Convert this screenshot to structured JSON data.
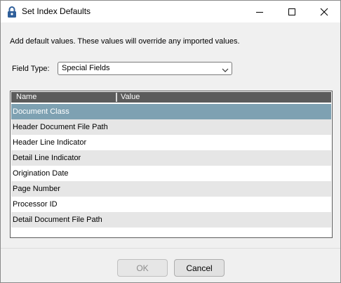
{
  "window": {
    "title": "Set Index Defaults"
  },
  "description": "Add default values. These values will override any imported values.",
  "field_type": {
    "label": "Field Type:",
    "selected": "Special Fields"
  },
  "grid": {
    "columns": [
      "Name",
      "Value"
    ],
    "rows": [
      {
        "name": "Document Class",
        "value": ""
      },
      {
        "name": "Header Document File Path",
        "value": ""
      },
      {
        "name": "Header Line Indicator",
        "value": ""
      },
      {
        "name": "Detail Line Indicator",
        "value": ""
      },
      {
        "name": "Origination Date",
        "value": ""
      },
      {
        "name": "Page Number",
        "value": ""
      },
      {
        "name": "Processor ID",
        "value": ""
      },
      {
        "name": "Detail Document File Path",
        "value": ""
      }
    ],
    "selected_index": 0
  },
  "buttons": {
    "ok": "OK",
    "cancel": "Cancel"
  },
  "colors": {
    "header": "#5b5b5b",
    "selected_row": "#7ea1b2",
    "alt_row": "#e6e6e6"
  }
}
